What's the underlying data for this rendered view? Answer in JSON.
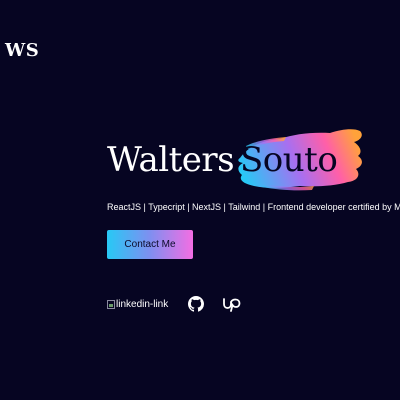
{
  "header": {
    "logo": "WS"
  },
  "hero": {
    "first_name": "Walters",
    "last_name": "Souto",
    "tagline": "ReactJS | Typecript | NextJS | Tailwind | Frontend developer certified by Meta",
    "contact_label": "Contact Me"
  },
  "socials": {
    "linkedin_alt": "linkedin-link",
    "icons": [
      "broken-image-icon",
      "github-icon",
      "upwork-icon"
    ]
  },
  "colors": {
    "background": "#060522",
    "text": "#ffffff",
    "brush_start": "#27c9f5",
    "brush_mid": "#a86ff0",
    "brush_end": "#ff9a3c",
    "button_start": "#27c9f5",
    "button_end": "#f36ee3"
  }
}
